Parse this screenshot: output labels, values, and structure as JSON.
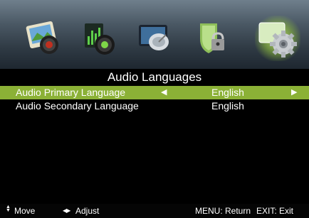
{
  "icons": [
    {
      "name": "picture-icon"
    },
    {
      "name": "sound-icon"
    },
    {
      "name": "channel-icon"
    },
    {
      "name": "lock-icon"
    },
    {
      "name": "setup-icon"
    }
  ],
  "selected_icon_index": 4,
  "menu": {
    "title": "Audio Languages",
    "rows": [
      {
        "label": "Audio Primary Language",
        "value": "English",
        "highlighted": true
      },
      {
        "label": "Audio Secondary Language",
        "value": "English",
        "highlighted": false
      }
    ]
  },
  "hints": {
    "move_icon": "▲▼",
    "move": "Move",
    "adjust_icon": "◀▶",
    "adjust": "Adjust",
    "menu_return": "MENU: Return",
    "exit": "EXIT: Exit"
  },
  "colors": {
    "highlight": "#8bb136",
    "background": "#000000"
  }
}
